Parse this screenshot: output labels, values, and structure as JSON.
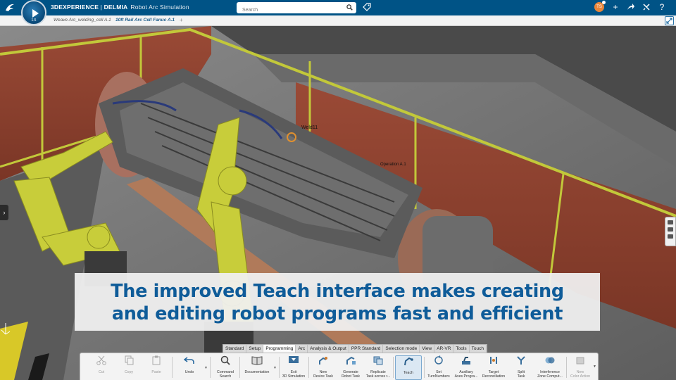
{
  "topbar": {
    "brand_bold": "3DEXPERIENCE",
    "brand_sep": " | ",
    "brand_product": "DELMIA",
    "brand_app": "Robot Arc Simulation",
    "compass_version": "1.5",
    "search_placeholder": "Search",
    "avatar_initials": "TS"
  },
  "tabs": [
    {
      "label": "Weave Arc_welding_cell A.1",
      "active": false
    },
    {
      "label": "10ft Rail Arc Cell Fanuc A.1",
      "active": true
    }
  ],
  "tab_add": "+",
  "viewport": {
    "labels": [
      "Weld11",
      "Operation A.1"
    ]
  },
  "caption": {
    "line1": "The improved Teach interface makes creating",
    "line2": "and editing robot programs fast and efficient"
  },
  "action_tabs": [
    {
      "label": "Standard",
      "active": false
    },
    {
      "label": "Setup",
      "active": false
    },
    {
      "label": "Programming",
      "active": true
    },
    {
      "label": "Arc",
      "active": false
    },
    {
      "label": "Analysis & Output",
      "active": false
    },
    {
      "label": "PPR Standard",
      "active": false
    },
    {
      "label": "Selection mode",
      "active": false
    },
    {
      "label": "View",
      "active": false
    },
    {
      "label": "AR-VR",
      "active": false
    },
    {
      "label": "Tools",
      "active": false
    },
    {
      "label": "Touch",
      "active": false
    }
  ],
  "commands": [
    {
      "label": "Cut",
      "icon": "scissors-icon",
      "disabled": true
    },
    {
      "label": "Copy",
      "icon": "copy-icon",
      "disabled": true
    },
    {
      "label": "Paste",
      "icon": "paste-icon",
      "disabled": true
    },
    {
      "label": "Undo",
      "icon": "undo-icon",
      "disabled": false
    },
    {
      "label": "Command\nSearch",
      "icon": "command-search-icon",
      "disabled": false
    },
    {
      "label": "Documentation",
      "icon": "book-icon",
      "disabled": false
    },
    {
      "label": "Exit\n3D Simulation",
      "icon": "exit-simulation-icon",
      "disabled": false
    },
    {
      "label": "New\nDevice Task",
      "icon": "device-task-icon",
      "disabled": false
    },
    {
      "label": "Generate\nRobot Task",
      "icon": "generate-robot-task-icon",
      "disabled": false
    },
    {
      "label": "Replicate\nTask across r...",
      "icon": "replicate-task-icon",
      "disabled": false
    },
    {
      "label": "Teach",
      "icon": "teach-icon",
      "disabled": false,
      "selected": true
    },
    {
      "label": "Set\nTurnNumbers",
      "icon": "turn-numbers-icon",
      "disabled": false
    },
    {
      "label": "Auxiliary\nAxes Progra...",
      "icon": "auxiliary-axes-icon",
      "disabled": false
    },
    {
      "label": "Target\nReconciliation",
      "icon": "target-reconciliation-icon",
      "disabled": false
    },
    {
      "label": "Split\nTask",
      "icon": "split-task-icon",
      "disabled": false
    },
    {
      "label": "Interference\nZone Comput...",
      "icon": "interference-zone-icon",
      "disabled": false
    },
    {
      "label": "New\nColor Action",
      "icon": "color-action-icon",
      "disabled": true
    }
  ],
  "colors": {
    "topbar": "#005386",
    "caption_text": "#0f5c99",
    "robot_yellow": "#c8cd3a",
    "wall_red": "#8c4030"
  }
}
